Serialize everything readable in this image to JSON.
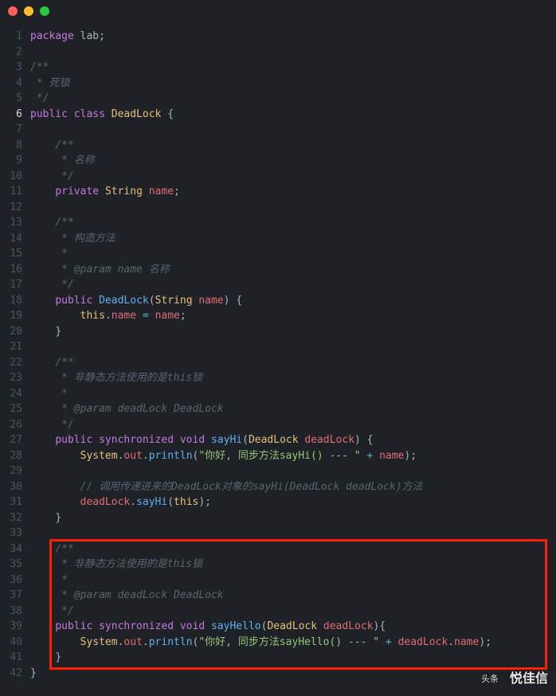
{
  "window": {
    "traffic_lights": [
      "close",
      "minimize",
      "zoom"
    ]
  },
  "gutter": {
    "active_line": 6,
    "start": 1,
    "end": 42
  },
  "code_lines": [
    {
      "t": [
        [
          "kw",
          "package "
        ],
        [
          "plain",
          "lab"
        ],
        [
          "punct",
          ";"
        ]
      ]
    },
    {
      "t": []
    },
    {
      "t": [
        [
          "cmt",
          "/**"
        ]
      ]
    },
    {
      "t": [
        [
          "cmt",
          " * 死锁"
        ]
      ]
    },
    {
      "t": [
        [
          "cmt",
          " */"
        ]
      ]
    },
    {
      "t": [
        [
          "kw",
          "public class "
        ],
        [
          "cls",
          "DeadLock"
        ],
        [
          "punct",
          " {"
        ]
      ]
    },
    {
      "t": []
    },
    {
      "t": [
        [
          "plain",
          "    "
        ],
        [
          "cmt",
          "/**"
        ]
      ]
    },
    {
      "t": [
        [
          "plain",
          "    "
        ],
        [
          "cmt",
          " * 名称"
        ]
      ]
    },
    {
      "t": [
        [
          "plain",
          "    "
        ],
        [
          "cmt",
          " */"
        ]
      ]
    },
    {
      "t": [
        [
          "plain",
          "    "
        ],
        [
          "kw",
          "private "
        ],
        [
          "cls",
          "String "
        ],
        [
          "field",
          "name"
        ],
        [
          "punct",
          ";"
        ]
      ]
    },
    {
      "t": []
    },
    {
      "t": [
        [
          "plain",
          "    "
        ],
        [
          "cmt",
          "/**"
        ]
      ]
    },
    {
      "t": [
        [
          "plain",
          "    "
        ],
        [
          "cmt",
          " * 构造方法"
        ]
      ]
    },
    {
      "t": [
        [
          "plain",
          "    "
        ],
        [
          "cmt",
          " *"
        ]
      ]
    },
    {
      "t": [
        [
          "plain",
          "    "
        ],
        [
          "cmt",
          " * @param name 名称"
        ]
      ]
    },
    {
      "t": [
        [
          "plain",
          "    "
        ],
        [
          "cmt",
          " */"
        ]
      ]
    },
    {
      "t": [
        [
          "plain",
          "    "
        ],
        [
          "kw",
          "public "
        ],
        [
          "fn",
          "DeadLock"
        ],
        [
          "punct",
          "("
        ],
        [
          "cls",
          "String "
        ],
        [
          "field",
          "name"
        ],
        [
          "punct",
          ")"
        ],
        [
          "punct",
          " {"
        ]
      ]
    },
    {
      "t": [
        [
          "plain",
          "        "
        ],
        [
          "this",
          "this"
        ],
        [
          "punct",
          "."
        ],
        [
          "field",
          "name"
        ],
        [
          "punct",
          " "
        ],
        [
          "op",
          "="
        ],
        [
          "punct",
          " "
        ],
        [
          "field",
          "name"
        ],
        [
          "punct",
          ";"
        ]
      ]
    },
    {
      "t": [
        [
          "plain",
          "    "
        ],
        [
          "punct",
          "}"
        ]
      ]
    },
    {
      "t": []
    },
    {
      "t": [
        [
          "plain",
          "    "
        ],
        [
          "cmt",
          "/**"
        ]
      ]
    },
    {
      "t": [
        [
          "plain",
          "    "
        ],
        [
          "cmt",
          " * 非静态方法使用的是this锁"
        ]
      ]
    },
    {
      "t": [
        [
          "plain",
          "    "
        ],
        [
          "cmt",
          " *"
        ]
      ]
    },
    {
      "t": [
        [
          "plain",
          "    "
        ],
        [
          "cmt",
          " * @param deadLock DeadLock"
        ]
      ]
    },
    {
      "t": [
        [
          "plain",
          "    "
        ],
        [
          "cmt",
          " */"
        ]
      ]
    },
    {
      "t": [
        [
          "plain",
          "    "
        ],
        [
          "kw",
          "public synchronized void "
        ],
        [
          "fn",
          "sayHi"
        ],
        [
          "punct",
          "("
        ],
        [
          "cls",
          "DeadLock "
        ],
        [
          "field",
          "deadLock"
        ],
        [
          "punct",
          ")"
        ],
        [
          "punct",
          " {"
        ]
      ]
    },
    {
      "t": [
        [
          "plain",
          "        "
        ],
        [
          "cls",
          "System"
        ],
        [
          "punct",
          "."
        ],
        [
          "field",
          "out"
        ],
        [
          "punct",
          "."
        ],
        [
          "fn",
          "println"
        ],
        [
          "punct",
          "("
        ],
        [
          "str",
          "\"你好, 同步方法sayHi() --- \""
        ],
        [
          "punct",
          " "
        ],
        [
          "op",
          "+"
        ],
        [
          "punct",
          " "
        ],
        [
          "field",
          "name"
        ],
        [
          "punct",
          ")"
        ],
        [
          "punct",
          ";"
        ]
      ]
    },
    {
      "t": []
    },
    {
      "t": [
        [
          "plain",
          "        "
        ],
        [
          "cmt",
          "// 调用传递进来的DeadLock对象的sayHi(DeadLock deadLock)方法"
        ]
      ]
    },
    {
      "t": [
        [
          "plain",
          "        "
        ],
        [
          "field",
          "deadLock"
        ],
        [
          "punct",
          "."
        ],
        [
          "fn",
          "sayHi"
        ],
        [
          "punct",
          "("
        ],
        [
          "this",
          "this"
        ],
        [
          "punct",
          ")"
        ],
        [
          "punct",
          ";"
        ]
      ]
    },
    {
      "t": [
        [
          "plain",
          "    "
        ],
        [
          "punct",
          "}"
        ]
      ]
    },
    {
      "t": []
    },
    {
      "t": [
        [
          "plain",
          "    "
        ],
        [
          "cmt",
          "/**"
        ]
      ]
    },
    {
      "t": [
        [
          "plain",
          "    "
        ],
        [
          "cmt",
          " * 非静态方法使用的是this锁"
        ]
      ]
    },
    {
      "t": [
        [
          "plain",
          "    "
        ],
        [
          "cmt",
          " *"
        ]
      ]
    },
    {
      "t": [
        [
          "plain",
          "    "
        ],
        [
          "cmt",
          " * @param deadLock DeadLock"
        ]
      ]
    },
    {
      "t": [
        [
          "plain",
          "    "
        ],
        [
          "cmt",
          " */"
        ]
      ]
    },
    {
      "t": [
        [
          "plain",
          "    "
        ],
        [
          "kw",
          "public synchronized void "
        ],
        [
          "fn",
          "sayHello"
        ],
        [
          "punct",
          "("
        ],
        [
          "cls",
          "DeadLock "
        ],
        [
          "field",
          "deadLock"
        ],
        [
          "punct",
          ")"
        ],
        [
          "punct",
          "{"
        ]
      ]
    },
    {
      "t": [
        [
          "plain",
          "        "
        ],
        [
          "cls",
          "System"
        ],
        [
          "punct",
          "."
        ],
        [
          "field",
          "out"
        ],
        [
          "punct",
          "."
        ],
        [
          "fn",
          "println"
        ],
        [
          "punct",
          "("
        ],
        [
          "str",
          "\"你好, 同步方法sayHello() --- \""
        ],
        [
          "punct",
          " "
        ],
        [
          "op",
          "+"
        ],
        [
          "punct",
          " "
        ],
        [
          "field",
          "deadLock"
        ],
        [
          "punct",
          "."
        ],
        [
          "field",
          "name"
        ],
        [
          "punct",
          ")"
        ],
        [
          "punct",
          ";"
        ]
      ]
    },
    {
      "t": [
        [
          "plain",
          "    "
        ],
        [
          "punct",
          "}"
        ]
      ]
    },
    {
      "t": [
        [
          "punct",
          "}"
        ]
      ]
    }
  ],
  "watermark": {
    "sub": "头条",
    "main": "悦佳信"
  }
}
